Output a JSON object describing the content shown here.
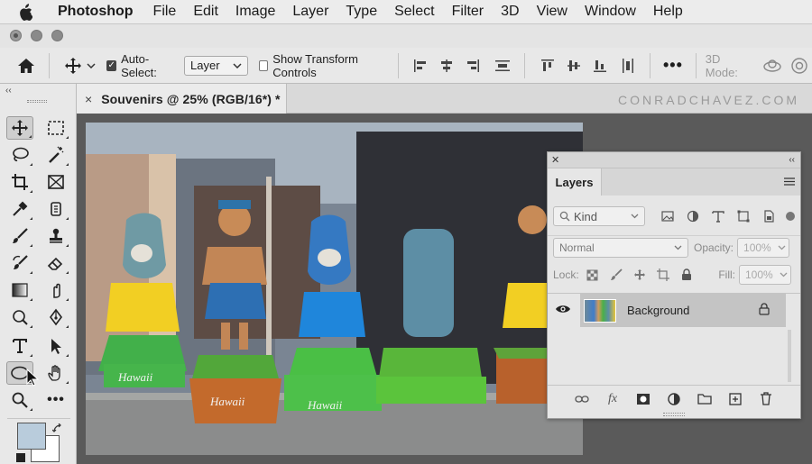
{
  "menubar": {
    "app": "Photoshop",
    "items": [
      "File",
      "Edit",
      "Image",
      "Layer",
      "Type",
      "Select",
      "Filter",
      "3D",
      "View",
      "Window",
      "Help"
    ]
  },
  "options": {
    "auto_select_label": "Auto-Select:",
    "auto_select_checked": true,
    "auto_select_target": "Layer",
    "show_transform_label": "Show Transform Controls",
    "show_transform_checked": false,
    "mode_3d_label": "3D Mode:"
  },
  "document": {
    "tab_title": "Souvenirs @ 25% (RGB/16*) *",
    "close_glyph": "×"
  },
  "watermark": "CONRADCHAVEZ.COM",
  "layers_panel": {
    "title": "Layers",
    "filter_kind": "Kind",
    "blend_mode": "Normal",
    "opacity_label": "Opacity:",
    "opacity_value": "100%",
    "lock_label": "Lock:",
    "fill_label": "Fill:",
    "fill_value": "100%",
    "layers": [
      {
        "name": "Background",
        "visible": true,
        "locked": true
      }
    ]
  },
  "photo": {
    "figure_labels": [
      "Hawaii",
      "Hawaii",
      "Hawaii"
    ]
  },
  "colors": {
    "foreground": "#b9ccdc",
    "background": "#ffffff",
    "panel_bg": "#e6e6e6",
    "selected_layer": "#c4c4c4"
  }
}
